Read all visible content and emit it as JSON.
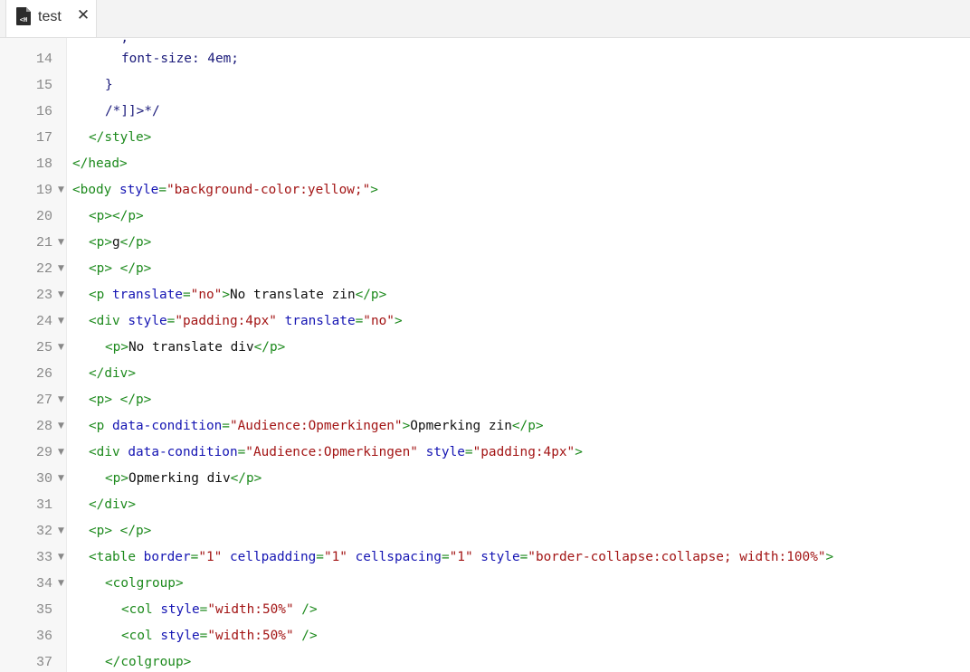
{
  "tab": {
    "title": "test",
    "icon": "html-file-icon",
    "close_icon": "close-icon",
    "close_glyph": "✕"
  },
  "lines": [
    {
      "num": "14",
      "fold": false,
      "indent": 3,
      "tokens": [
        {
          "t": "css",
          "v": "font-size: 4em;"
        }
      ]
    },
    {
      "num": "15",
      "fold": false,
      "indent": 2,
      "tokens": [
        {
          "t": "css",
          "v": "}"
        }
      ]
    },
    {
      "num": "16",
      "fold": false,
      "indent": 2,
      "tokens": [
        {
          "t": "css",
          "v": "/*]]>*/"
        }
      ]
    },
    {
      "num": "17",
      "fold": false,
      "indent": 1,
      "tokens": [
        {
          "t": "tag",
          "v": "</style>"
        }
      ]
    },
    {
      "num": "18",
      "fold": false,
      "indent": 0,
      "tokens": [
        {
          "t": "tag",
          "v": "</head>"
        }
      ]
    },
    {
      "num": "19",
      "fold": true,
      "indent": 0,
      "tokens": [
        {
          "t": "tag",
          "v": "<body "
        },
        {
          "t": "attr",
          "v": "style"
        },
        {
          "t": "tag",
          "v": "="
        },
        {
          "t": "val",
          "v": "\"background-color:yellow;\""
        },
        {
          "t": "tag",
          "v": ">"
        }
      ]
    },
    {
      "num": "20",
      "fold": false,
      "indent": 1,
      "tokens": [
        {
          "t": "tag",
          "v": "<p></p>"
        }
      ]
    },
    {
      "num": "21",
      "fold": true,
      "indent": 1,
      "tokens": [
        {
          "t": "tag",
          "v": "<p>"
        },
        {
          "t": "text",
          "v": "g"
        },
        {
          "t": "tag",
          "v": "</p>"
        }
      ]
    },
    {
      "num": "22",
      "fold": true,
      "indent": 1,
      "tokens": [
        {
          "t": "tag",
          "v": "<p>"
        },
        {
          "t": "text",
          "v": " "
        },
        {
          "t": "tag",
          "v": "</p>"
        }
      ]
    },
    {
      "num": "23",
      "fold": true,
      "indent": 1,
      "tokens": [
        {
          "t": "tag",
          "v": "<p "
        },
        {
          "t": "attr",
          "v": "translate"
        },
        {
          "t": "tag",
          "v": "="
        },
        {
          "t": "val",
          "v": "\"no\""
        },
        {
          "t": "tag",
          "v": ">"
        },
        {
          "t": "text",
          "v": "No translate zin"
        },
        {
          "t": "tag",
          "v": "</p>"
        }
      ]
    },
    {
      "num": "24",
      "fold": true,
      "indent": 1,
      "tokens": [
        {
          "t": "tag",
          "v": "<div "
        },
        {
          "t": "attr",
          "v": "style"
        },
        {
          "t": "tag",
          "v": "="
        },
        {
          "t": "val",
          "v": "\"padding:4px\""
        },
        {
          "t": "text",
          "v": " "
        },
        {
          "t": "attr",
          "v": "translate"
        },
        {
          "t": "tag",
          "v": "="
        },
        {
          "t": "val",
          "v": "\"no\""
        },
        {
          "t": "tag",
          "v": ">"
        }
      ]
    },
    {
      "num": "25",
      "fold": true,
      "indent": 2,
      "tokens": [
        {
          "t": "tag",
          "v": "<p>"
        },
        {
          "t": "text",
          "v": "No translate div"
        },
        {
          "t": "tag",
          "v": "</p>"
        }
      ]
    },
    {
      "num": "26",
      "fold": false,
      "indent": 1,
      "tokens": [
        {
          "t": "tag",
          "v": "</div>"
        }
      ]
    },
    {
      "num": "27",
      "fold": true,
      "indent": 1,
      "tokens": [
        {
          "t": "tag",
          "v": "<p>"
        },
        {
          "t": "text",
          "v": " "
        },
        {
          "t": "tag",
          "v": "</p>"
        }
      ]
    },
    {
      "num": "28",
      "fold": true,
      "indent": 1,
      "tokens": [
        {
          "t": "tag",
          "v": "<p "
        },
        {
          "t": "attr",
          "v": "data-condition"
        },
        {
          "t": "tag",
          "v": "="
        },
        {
          "t": "val",
          "v": "\"Audience:Opmerkingen\""
        },
        {
          "t": "tag",
          "v": ">"
        },
        {
          "t": "text",
          "v": "Opmerking zin"
        },
        {
          "t": "tag",
          "v": "</p>"
        }
      ]
    },
    {
      "num": "29",
      "fold": true,
      "indent": 1,
      "tokens": [
        {
          "t": "tag",
          "v": "<div "
        },
        {
          "t": "attr",
          "v": "data-condition"
        },
        {
          "t": "tag",
          "v": "="
        },
        {
          "t": "val",
          "v": "\"Audience:Opmerkingen\""
        },
        {
          "t": "text",
          "v": " "
        },
        {
          "t": "attr",
          "v": "style"
        },
        {
          "t": "tag",
          "v": "="
        },
        {
          "t": "val",
          "v": "\"padding:4px\""
        },
        {
          "t": "tag",
          "v": ">"
        }
      ]
    },
    {
      "num": "30",
      "fold": true,
      "indent": 2,
      "tokens": [
        {
          "t": "tag",
          "v": "<p>"
        },
        {
          "t": "text",
          "v": "Opmerking div"
        },
        {
          "t": "tag",
          "v": "</p>"
        }
      ]
    },
    {
      "num": "31",
      "fold": false,
      "indent": 1,
      "tokens": [
        {
          "t": "tag",
          "v": "</div>"
        }
      ]
    },
    {
      "num": "32",
      "fold": true,
      "indent": 1,
      "tokens": [
        {
          "t": "tag",
          "v": "<p>"
        },
        {
          "t": "text",
          "v": " "
        },
        {
          "t": "tag",
          "v": "</p>"
        }
      ]
    },
    {
      "num": "33",
      "fold": true,
      "indent": 1,
      "tokens": [
        {
          "t": "tag",
          "v": "<table "
        },
        {
          "t": "attr",
          "v": "border"
        },
        {
          "t": "tag",
          "v": "="
        },
        {
          "t": "val",
          "v": "\"1\""
        },
        {
          "t": "text",
          "v": " "
        },
        {
          "t": "attr",
          "v": "cellpadding"
        },
        {
          "t": "tag",
          "v": "="
        },
        {
          "t": "val",
          "v": "\"1\""
        },
        {
          "t": "text",
          "v": " "
        },
        {
          "t": "attr",
          "v": "cellspacing"
        },
        {
          "t": "tag",
          "v": "="
        },
        {
          "t": "val",
          "v": "\"1\""
        },
        {
          "t": "text",
          "v": " "
        },
        {
          "t": "attr",
          "v": "style"
        },
        {
          "t": "tag",
          "v": "="
        },
        {
          "t": "val",
          "v": "\"border-collapse:collapse; width:100%\""
        },
        {
          "t": "tag",
          "v": ">"
        }
      ]
    },
    {
      "num": "34",
      "fold": true,
      "indent": 2,
      "tokens": [
        {
          "t": "tag",
          "v": "<colgroup>"
        }
      ]
    },
    {
      "num": "35",
      "fold": false,
      "indent": 3,
      "tokens": [
        {
          "t": "tag",
          "v": "<col "
        },
        {
          "t": "attr",
          "v": "style"
        },
        {
          "t": "tag",
          "v": "="
        },
        {
          "t": "val",
          "v": "\"width:50%\""
        },
        {
          "t": "tag",
          "v": " />"
        }
      ]
    },
    {
      "num": "36",
      "fold": false,
      "indent": 3,
      "tokens": [
        {
          "t": "tag",
          "v": "<col "
        },
        {
          "t": "attr",
          "v": "style"
        },
        {
          "t": "tag",
          "v": "="
        },
        {
          "t": "val",
          "v": "\"width:50%\""
        },
        {
          "t": "tag",
          "v": " />"
        }
      ]
    },
    {
      "num": "37",
      "fold": false,
      "indent": 2,
      "tokens": [
        {
          "t": "tag",
          "v": "</colgroup>"
        }
      ]
    }
  ],
  "colors": {
    "tag": "#1d8a1d",
    "attr": "#1515b3",
    "value": "#a31515",
    "text": "#111111",
    "css": "#1a1a7a"
  }
}
